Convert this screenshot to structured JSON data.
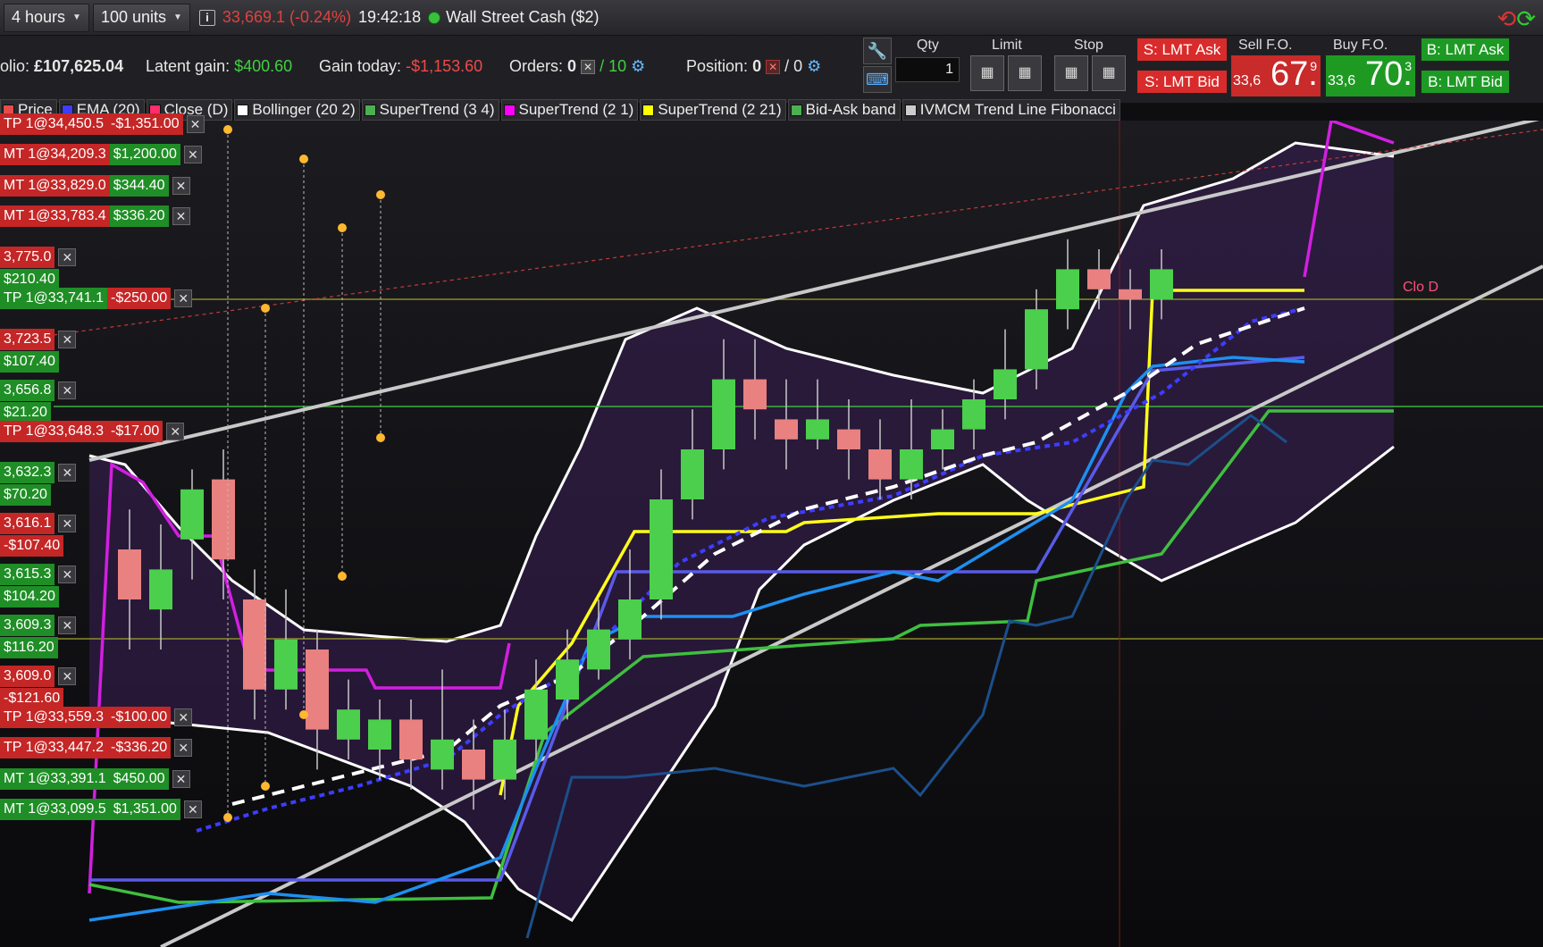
{
  "topbar": {
    "timeframe": "4 hours",
    "size": "100 units",
    "info": "i",
    "quote": "33,669.1 (-0.24%)",
    "time": "19:42:18",
    "account": "Wall Street Cash ($2)"
  },
  "stats": {
    "portfolio_label": "olio:",
    "portfolio_value": "£107,625.04",
    "latent_label": "Latent gain:",
    "latent_value": "$400.60",
    "today_label": "Gain today:",
    "today_value": "-$1,153.60",
    "orders_label": "Orders:",
    "orders_a": "0",
    "orders_b": "/ 10",
    "position_label": "Position:",
    "position_a": "0",
    "position_b": "/ 0"
  },
  "ticket": {
    "qty_label": "Qty",
    "qty_value": "1",
    "limit_label": "Limit",
    "stop_label": "Stop",
    "s_lmt_ask": "S: LMT Ask",
    "s_lmt_bid": "S: LMT Bid",
    "sell_label": "Sell F.O.",
    "sell_pre": "33,6",
    "sell_big": "67.",
    "sell_sup": "9",
    "buy_label": "Buy F.O.",
    "buy_pre": "33,6",
    "buy_big": "70.",
    "buy_sup": "3",
    "b_lmt_ask": "B: LMT Ask",
    "b_lmt_bid": "B: LMT Bid"
  },
  "legend": [
    {
      "label": "Price",
      "color": "#e74c4c"
    },
    {
      "label": "EMA (20)",
      "color": "#3d3dff"
    },
    {
      "label": "Close (D)",
      "color": "#ff2d6a"
    },
    {
      "label": "Bollinger (20 2)",
      "color": "#ffffff"
    },
    {
      "label": "SuperTrend (3 4)",
      "color": "#4caf50"
    },
    {
      "label": "SuperTrend (2 1)",
      "color": "#ff00ff"
    },
    {
      "label": "SuperTrend (2 21)",
      "color": "#ffff00"
    },
    {
      "label": "Bid-Ask band",
      "color": "#4caf50"
    },
    {
      "label": "IVMCM Trend Line Fibonacci",
      "color": "#cccccc"
    }
  ],
  "orders": [
    {
      "name": "TP 1@34,450.5",
      "pl": "-$1,351.00",
      "type": "r",
      "plt": "r"
    },
    {
      "name": "MT 1@34,209.3",
      "pl": "$1,200.00",
      "type": "r",
      "plt": "g"
    },
    {
      "name": "MT 1@33,829.0",
      "pl": "$344.40",
      "type": "r",
      "plt": "g"
    },
    {
      "name": "MT 1@33,783.4",
      "pl": "$336.20",
      "type": "r",
      "plt": "g"
    },
    {
      "name": "3,775.0",
      "pl": "",
      "type": "r",
      "plt": ""
    },
    {
      "name": "$210.40",
      "pl": "",
      "type": "g",
      "plt": "",
      "nox": true
    },
    {
      "name": "TP 1@33,741.1",
      "pl": "-$250.00",
      "type": "g",
      "plt": "r"
    },
    {
      "name": "3,723.5",
      "pl": "",
      "type": "r",
      "plt": ""
    },
    {
      "name": "$107.40",
      "pl": "",
      "type": "g",
      "plt": "",
      "nox": true
    },
    {
      "name": "3,656.8",
      "pl": "",
      "type": "g",
      "plt": ""
    },
    {
      "name": "$21.20",
      "pl": "",
      "type": "g",
      "plt": "",
      "nox": true
    },
    {
      "name": "TP 1@33,648.3",
      "pl": "-$17.00",
      "type": "r",
      "plt": "r"
    },
    {
      "name": "3,632.3",
      "pl": "",
      "type": "g",
      "plt": ""
    },
    {
      "name": "$70.20",
      "pl": "",
      "type": "g",
      "plt": "",
      "nox": true
    },
    {
      "name": "3,616.1",
      "pl": "",
      "type": "r",
      "plt": ""
    },
    {
      "name": "-$107.40",
      "pl": "",
      "type": "r",
      "plt": "",
      "nox": true
    },
    {
      "name": "3,615.3",
      "pl": "",
      "type": "g",
      "plt": ""
    },
    {
      "name": "$104.20",
      "pl": "",
      "type": "g",
      "plt": "",
      "nox": true
    },
    {
      "name": "3,609.3",
      "pl": "",
      "type": "g",
      "plt": ""
    },
    {
      "name": "$116.20",
      "pl": "",
      "type": "g",
      "plt": "",
      "nox": true
    },
    {
      "name": "3,609.0",
      "pl": "",
      "type": "r",
      "plt": ""
    },
    {
      "name": "-$121.60",
      "pl": "",
      "type": "r",
      "plt": "",
      "nox": true
    },
    {
      "name": "TP 1@33,559.3",
      "pl": "-$100.00",
      "type": "r",
      "plt": "r"
    },
    {
      "name": "TP 1@33,447.2",
      "pl": "-$336.20",
      "type": "r",
      "plt": "r"
    },
    {
      "name": "MT 1@33,391.1",
      "pl": "$450.00",
      "type": "g",
      "plt": "g"
    },
    {
      "name": "MT 1@33,099.5",
      "pl": "$1,351.00",
      "type": "g",
      "plt": "g"
    }
  ],
  "close_label": "Clo D",
  "chart_data": {
    "type": "candlestick",
    "candles": [
      {
        "o": 0.5,
        "c": 0.4,
        "h": 0.58,
        "l": 0.3
      },
      {
        "o": 0.38,
        "c": 0.46,
        "h": 0.55,
        "l": 0.3
      },
      {
        "o": 0.52,
        "c": 0.62,
        "h": 0.66,
        "l": 0.44
      },
      {
        "o": 0.64,
        "c": 0.48,
        "h": 0.7,
        "l": 0.4
      },
      {
        "o": 0.4,
        "c": 0.22,
        "h": 0.46,
        "l": 0.16
      },
      {
        "o": 0.22,
        "c": 0.32,
        "h": 0.42,
        "l": 0.18
      },
      {
        "o": 0.3,
        "c": 0.14,
        "h": 0.34,
        "l": 0.06
      },
      {
        "o": 0.12,
        "c": 0.18,
        "h": 0.24,
        "l": 0.08
      },
      {
        "o": 0.1,
        "c": 0.16,
        "h": 0.2,
        "l": 0.04
      },
      {
        "o": 0.16,
        "c": 0.08,
        "h": 0.2,
        "l": 0.02
      },
      {
        "o": 0.06,
        "c": 0.12,
        "h": 0.26,
        "l": 0.02
      },
      {
        "o": 0.1,
        "c": 0.04,
        "h": 0.16,
        "l": -0.02
      },
      {
        "o": 0.04,
        "c": 0.12,
        "h": 0.18,
        "l": 0.0
      },
      {
        "o": 0.12,
        "c": 0.22,
        "h": 0.28,
        "l": 0.08
      },
      {
        "o": 0.2,
        "c": 0.28,
        "h": 0.34,
        "l": 0.16
      },
      {
        "o": 0.26,
        "c": 0.34,
        "h": 0.4,
        "l": 0.24
      },
      {
        "o": 0.32,
        "c": 0.4,
        "h": 0.5,
        "l": 0.28
      },
      {
        "o": 0.4,
        "c": 0.6,
        "h": 0.66,
        "l": 0.36
      },
      {
        "o": 0.6,
        "c": 0.7,
        "h": 0.78,
        "l": 0.56
      },
      {
        "o": 0.7,
        "c": 0.84,
        "h": 0.92,
        "l": 0.66
      },
      {
        "o": 0.84,
        "c": 0.78,
        "h": 0.92,
        "l": 0.72
      },
      {
        "o": 0.76,
        "c": 0.72,
        "h": 0.84,
        "l": 0.66
      },
      {
        "o": 0.72,
        "c": 0.76,
        "h": 0.84,
        "l": 0.7
      },
      {
        "o": 0.74,
        "c": 0.7,
        "h": 0.8,
        "l": 0.64
      },
      {
        "o": 0.7,
        "c": 0.64,
        "h": 0.76,
        "l": 0.6
      },
      {
        "o": 0.64,
        "c": 0.7,
        "h": 0.8,
        "l": 0.6
      },
      {
        "o": 0.7,
        "c": 0.74,
        "h": 0.78,
        "l": 0.66
      },
      {
        "o": 0.74,
        "c": 0.8,
        "h": 0.84,
        "l": 0.7
      },
      {
        "o": 0.8,
        "c": 0.86,
        "h": 0.94,
        "l": 0.76
      },
      {
        "o": 0.86,
        "c": 0.98,
        "h": 1.02,
        "l": 0.82
      },
      {
        "o": 0.98,
        "c": 1.06,
        "h": 1.12,
        "l": 0.94
      },
      {
        "o": 1.06,
        "c": 1.02,
        "h": 1.1,
        "l": 0.98
      },
      {
        "o": 1.02,
        "c": 1.0,
        "h": 1.06,
        "l": 0.94
      },
      {
        "o": 1.0,
        "c": 1.06,
        "h": 1.1,
        "l": 0.96
      }
    ]
  }
}
